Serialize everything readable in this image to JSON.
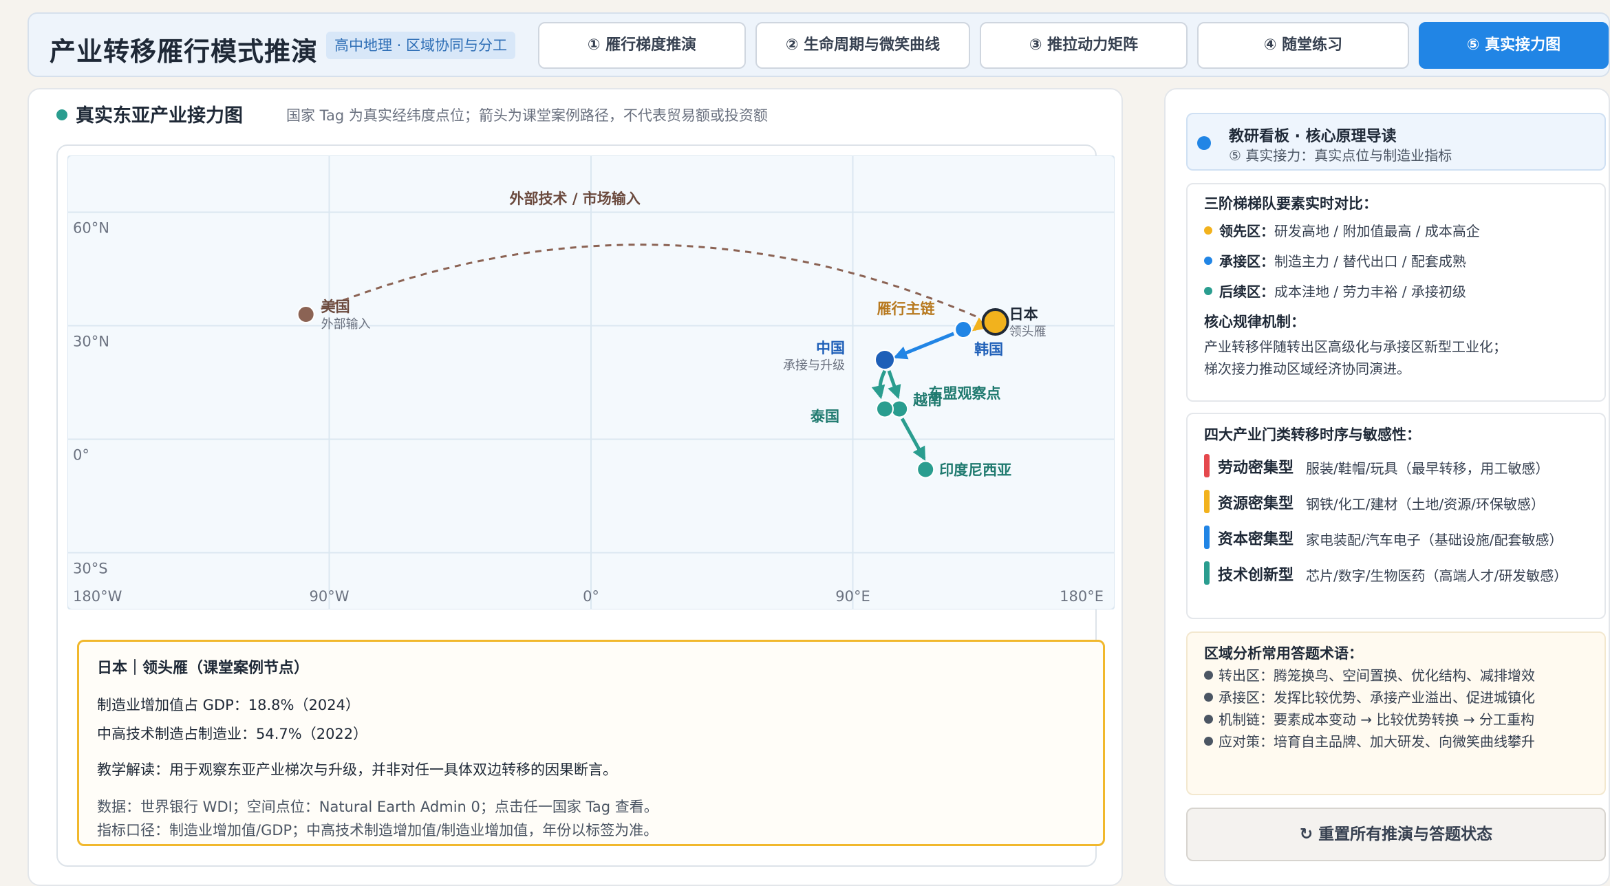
{
  "header": {
    "title": "产业转移雁行模式推演",
    "badge": "高中地理 · 区域协同与分工",
    "tabs": [
      {
        "label": "① 雁行梯度推演"
      },
      {
        "label": "② 生命周期与微笑曲线"
      },
      {
        "label": "③ 推拉动力矩阵"
      },
      {
        "label": "④ 随堂练习"
      },
      {
        "label": "⑤ 真实接力图"
      }
    ],
    "active_tab": 4
  },
  "map_panel": {
    "title": "真实东亚产业接力图",
    "note": "国家 Tag 为真实经纬度点位；箭头为课堂案例路径，不代表贸易额或投资额",
    "lat_labels": [
      "60°N",
      "30°N",
      "0°",
      "30°S"
    ],
    "lon_labels": [
      "180°W",
      "90°W",
      "0°",
      "90°E",
      "180°E"
    ],
    "arc_label": "外部技术 / 市场输入",
    "chain_label": "雁行主链",
    "asean_label": "东盟观察点",
    "countries": [
      {
        "name": "美国",
        "sub": "外部输入",
        "lon": -98,
        "lat": 33,
        "color": "#8b6354"
      },
      {
        "name": "日本",
        "sub": "领头雁",
        "lon": 139,
        "lat": 31,
        "color": "#f2b21d"
      },
      {
        "name": "韩国",
        "sub": "",
        "lon": 128,
        "lat": 29,
        "color": "#2185e5"
      },
      {
        "name": "中国",
        "sub": "承接与升级",
        "lon": 101,
        "lat": 21,
        "color": "#1e5fb8"
      },
      {
        "name": "越南",
        "sub": "",
        "lon": 106,
        "lat": 8,
        "color": "#2a9d8f"
      },
      {
        "name": "泰国",
        "sub": "",
        "lon": 101,
        "lat": 8,
        "color": "#2a9d8f"
      },
      {
        "name": "印度尼西亚",
        "sub": "",
        "lon": 115,
        "lat": -8,
        "color": "#2a9d8f"
      }
    ],
    "info": {
      "title": "日本｜领头雁（课堂案例节点）",
      "line1": "制造业增加值占 GDP：18.8%（2024）",
      "line2": "中高技术制造占制造业：54.7%（2022）",
      "line3": "教学解读：用于观察东亚产业梯次与升级，并非对任一具体双边转移的因果断言。",
      "line4": "数据：世界银行 WDI；空间点位：Natural Earth Admin 0；点击任一国家 Tag 查看。",
      "line5": "指标口径：制造业增加值/GDP；中高技术制造增加值/制造业增加值，年份以标签为准。"
    }
  },
  "sidebar": {
    "guide_title": "教研看板 · 核心原理导读",
    "guide_sub": "⑤ 真实接力：真实点位与制造业指标",
    "tiers_heading": "三阶梯梯队要素实时对比：",
    "tiers": [
      {
        "name": "领先区：",
        "desc": "研发高地 / 附加值最高 / 成本高企",
        "color": "#f2b21d"
      },
      {
        "name": "承接区：",
        "desc": "制造主力 / 替代出口 / 配套成熟",
        "color": "#2185e5"
      },
      {
        "name": "后续区：",
        "desc": "成本洼地 / 劳力丰裕 / 承接初级",
        "color": "#2a9d8f"
      }
    ],
    "mechanism_heading": "核心规律机制：",
    "mechanism_lines": [
      "产业转移伴随转出区高级化与承接区新型工业化；",
      "梯次接力推动区域经济协同演进。"
    ],
    "industries_heading": "四大产业门类转移时序与敏感性：",
    "industries": [
      {
        "name": "劳动密集型",
        "desc": "服装/鞋帽/玩具（最早转移，用工敏感）",
        "color": "#e5484d"
      },
      {
        "name": "资源密集型",
        "desc": "钢铁/化工/建材（土地/资源/环保敏感）",
        "color": "#f2b21d"
      },
      {
        "name": "资本密集型",
        "desc": "家电装配/汽车电子（基础设施/配套敏感）",
        "color": "#2185e5"
      },
      {
        "name": "技术创新型",
        "desc": "芯片/数字/生物医药（高端人才/研发敏感）",
        "color": "#2a9d8f"
      }
    ],
    "terms_heading": "区域分析常用答题术语：",
    "terms": [
      "转出区：腾笼换鸟、空间置换、优化结构、减排增效",
      "承接区：发挥比较优势、承接产业溢出、促进城镇化",
      "机制链：要素成本变动 → 比较优势转换 → 分工重构",
      "应对策：培育自主品牌、加大研发、向微笑曲线攀升"
    ],
    "reset_label": "重置所有推演与答题状态",
    "reset_icon": "reset-icon"
  }
}
